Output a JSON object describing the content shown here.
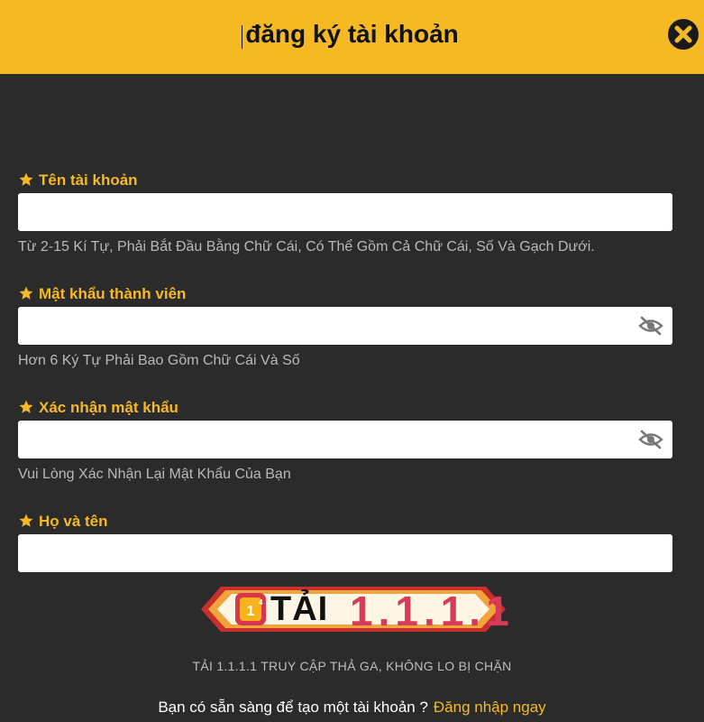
{
  "header": {
    "title": "đăng ký tài khoản"
  },
  "fields": [
    {
      "label": "Tên tài khoản",
      "value": "",
      "hint": "Từ 2-15 Kí Tự, Phải Bắt Đầu Bằng Chữ Cái, Có Thể Gồm Cả Chữ Cái, Số Và Gạch Dưới.",
      "has_eye": false
    },
    {
      "label": "Mật khẩu thành viên",
      "value": "",
      "hint": "Hơn 6 Ký Tự Phải Bao Gồm Chữ Cái Và Số",
      "has_eye": true
    },
    {
      "label": "Xác nhận mật khẩu",
      "value": "",
      "hint": "Vui Lòng Xác Nhận Lại Mật Khẩu Của Bạn",
      "has_eye": true
    },
    {
      "label": "Họ và tên",
      "value": "",
      "has_eye": false
    }
  ],
  "banner": {
    "prefix": "TẢI",
    "number": "1.1.1.1"
  },
  "tagline": "TẢI 1.1.1.1 TRUY CẬP THẢ GA, KHÔNG LO BỊ CHẶN",
  "footer": {
    "prompt": "Bạn có sẵn sàng để tạo một tài khoản ?",
    "login_link": "Đăng nhập ngay"
  },
  "icons": {
    "close": "close-icon",
    "star": "star-icon",
    "eye": "eye-slash-icon"
  },
  "colors": {
    "accent": "#f5b923",
    "background": "#2b2b2c",
    "hint": "#b9b9b9"
  }
}
